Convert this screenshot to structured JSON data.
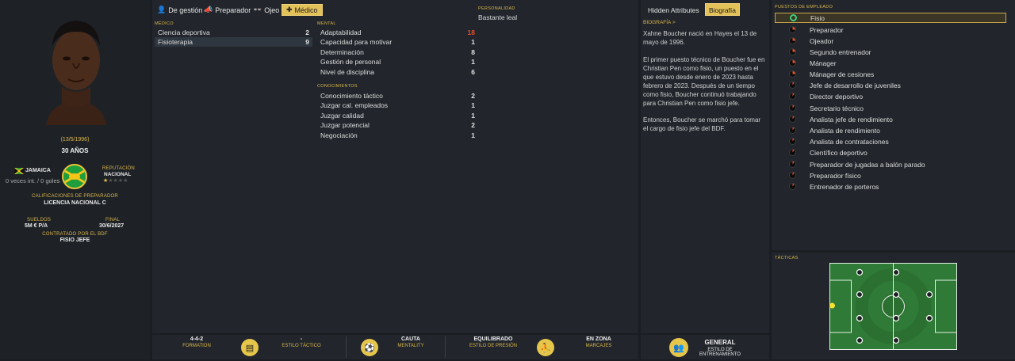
{
  "staff": {
    "birth": "(13/5/1996)",
    "age": "30 AÑOS",
    "nationality": "JAMAICA",
    "caps": "0 veces int. / 0 goles",
    "reputation_label": "REPUTACIÓN",
    "reputation": "NACIONAL",
    "reputation_stars": 1,
    "coach_label": "CALIFICACIONES DE PREPARADOR",
    "coach_license": "LICENCIA NACIONAL C",
    "wages_label": "SUELDOS",
    "wages": "5M € P/A",
    "contract_label": "FINAL",
    "contract_end": "30/6/2027",
    "contracted_label": "CONTRATADO POR EL BDF",
    "role": "FISIO JEFE",
    "flag_colors": [
      "#1e9e3c",
      "#f5c518",
      "#111111"
    ]
  },
  "tabs": [
    "De gestión",
    "Preparador",
    "Ojeo",
    "Médico"
  ],
  "personality": {
    "label": "PERSONALIDAD",
    "value": "Bastante leal"
  },
  "medico": {
    "label": "MÉDICO",
    "items": [
      {
        "name": "Ciencia deportiva",
        "value": "2"
      },
      {
        "name": "Fisioterapia",
        "value": "9"
      }
    ]
  },
  "mental": {
    "label": "MENTAL",
    "items": [
      {
        "name": "Adaptabilidad",
        "value": "18"
      },
      {
        "name": "Capacidad para motivar",
        "value": "1"
      },
      {
        "name": "Determinación",
        "value": "8"
      },
      {
        "name": "Gestión de personal",
        "value": "1"
      },
      {
        "name": "Nivel de disciplina",
        "value": "6"
      }
    ]
  },
  "knowledge": {
    "label": "CONOCIMIENTOS",
    "items": [
      {
        "name": "Conocimiento táctico",
        "value": "2"
      },
      {
        "name": "Juzgar cal. empleados",
        "value": "1"
      },
      {
        "name": "Juzgar calidad",
        "value": "1"
      },
      {
        "name": "Juzgar potencial",
        "value": "2"
      },
      {
        "name": "Negociación",
        "value": "1"
      }
    ]
  },
  "bio": {
    "tab1": "Hidden Attributes",
    "tab2": "Biografía",
    "label": "BIOGRAFÍA >",
    "p1": "Xahne Boucher nació en Hayes el 13 de mayo de 1996.",
    "p2": "El primer puesto técnico de Boucher fue en Christian Pen como fisio, un puesto en el que estuvo desde enero de 2023 hasta febrero de 2023. Después de un tiempo como fisio, Boucher continuó trabajando para Christian Pen como fisio jefe.",
    "p3": "Entonces, Boucher se marchó para tomar el cargo de fisio jefe del BDF."
  },
  "roles": {
    "label": "PUESTOS DE EMPLEADO",
    "items": [
      "Fisio",
      "Preparador",
      "Ojeador",
      "Segundo entrenador",
      "Mánager",
      "Mánager de cesiones",
      "Jefe de desarrollo de juveniles",
      "Director deportivo",
      "Secretario técnico",
      "Analista jefe de rendimiento",
      "Analista de rendimiento",
      "Analista de contrataciones",
      "Científico deportivo",
      "Preparador de jugadas a balón parado",
      "Preparador físico",
      "Entrenador de porteros"
    ]
  },
  "tactics": {
    "label": "TÁCTICAS"
  },
  "bottom": {
    "formation": "4-4-2",
    "formation_label": "FORMATION",
    "style": "-",
    "style_label": "ESTILO TÁCTICO",
    "mentality": "CAUTA",
    "mentality_label": "MENTALITY",
    "press": "EQUILIBRADO",
    "press_label": "ESTILO DE PRESIÓN",
    "marking": "EN ZONA",
    "marking_label": "MARCAJES",
    "training": "GENERAL",
    "training_label": "ESTILO DE ENTRENAMIENTO"
  }
}
